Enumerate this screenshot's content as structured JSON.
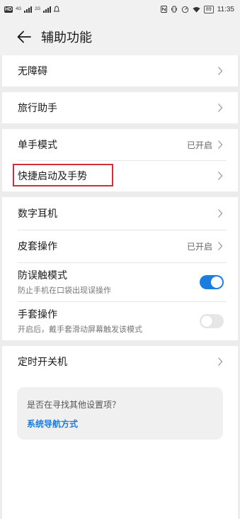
{
  "status_bar": {
    "hd_label": "HD",
    "network_1": "4G",
    "network_2": "2G",
    "battery": "89",
    "time": "11:35"
  },
  "header": {
    "title": "辅助功能",
    "back_icon": "arrow-left-icon"
  },
  "items": {
    "accessibility": {
      "label": "无障碍"
    },
    "travel": {
      "label": "旅行助手"
    },
    "one_hand": {
      "label": "单手模式",
      "value": "已开启"
    },
    "shortcuts": {
      "label": "快捷启动及手势"
    },
    "digital_earphone": {
      "label": "数字耳机"
    },
    "cover": {
      "label": "皮套操作",
      "value": "已开启"
    },
    "pocket_mode": {
      "label": "防误触模式",
      "subtitle": "防止手机在口袋出现误操作",
      "enabled": true
    },
    "glove_mode": {
      "label": "手套操作",
      "subtitle": "开启后，戴手套滑动屏幕触发该模式",
      "enabled": false
    },
    "schedule_power": {
      "label": "定时开关机"
    }
  },
  "suggestion": {
    "question": "是否在寻找其他设置项？",
    "link": "系统导航方式"
  },
  "colors": {
    "accent": "#1b7de0",
    "highlight": "#d32f3a"
  }
}
